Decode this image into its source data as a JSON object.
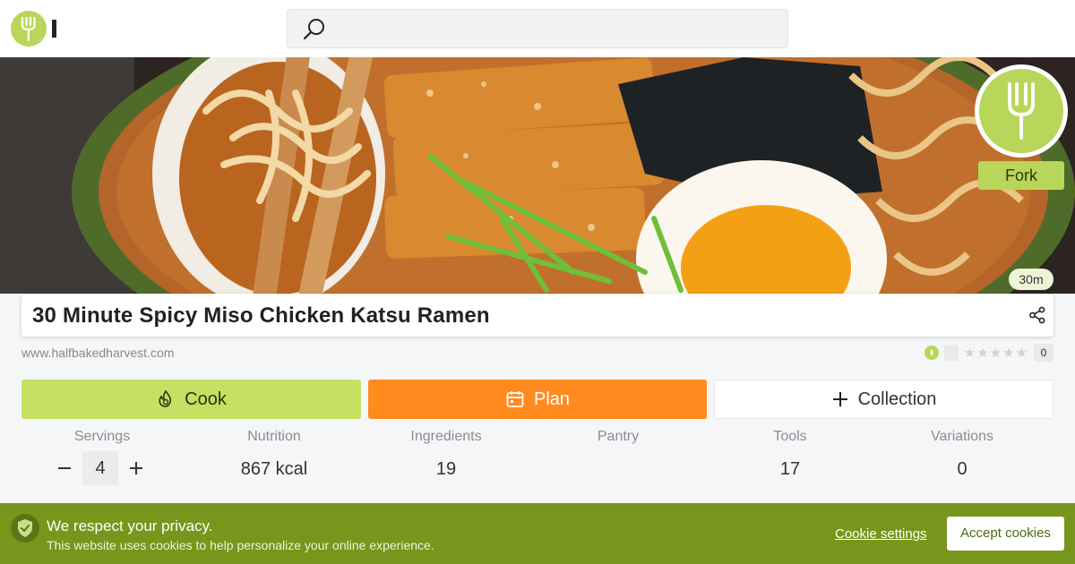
{
  "header": {
    "search_placeholder": ""
  },
  "hero": {
    "fork_label": "Fork",
    "time": "30m"
  },
  "recipe": {
    "title": "30 Minute Spicy Miso Chicken Katsu Ramen",
    "source": "www.halfbakedharvest.com",
    "rating_count": "0",
    "stars": "★★★★★"
  },
  "actions": {
    "cook": "Cook",
    "plan": "Plan",
    "collection": "Collection"
  },
  "stats": {
    "servings": {
      "label": "Servings",
      "value": "4",
      "minus": "−",
      "plus": "+"
    },
    "nutrition": {
      "label": "Nutrition",
      "value": "867 kcal"
    },
    "ingredients": {
      "label": "Ingredients",
      "value": "19"
    },
    "pantry": {
      "label": "Pantry",
      "value": ""
    },
    "tools": {
      "label": "Tools",
      "value": "17"
    },
    "variations": {
      "label": "Variations",
      "value": "0"
    }
  },
  "cookie": {
    "heading": "We respect your privacy.",
    "text": "This website uses cookies to help personalize your online experience.",
    "settings": "Cookie settings",
    "accept": "Accept cookies"
  },
  "colors": {
    "brand_green": "#b8d65a",
    "cook_green": "#c5e062",
    "plan_orange": "#ff8a1e",
    "banner_green": "#76961c"
  }
}
